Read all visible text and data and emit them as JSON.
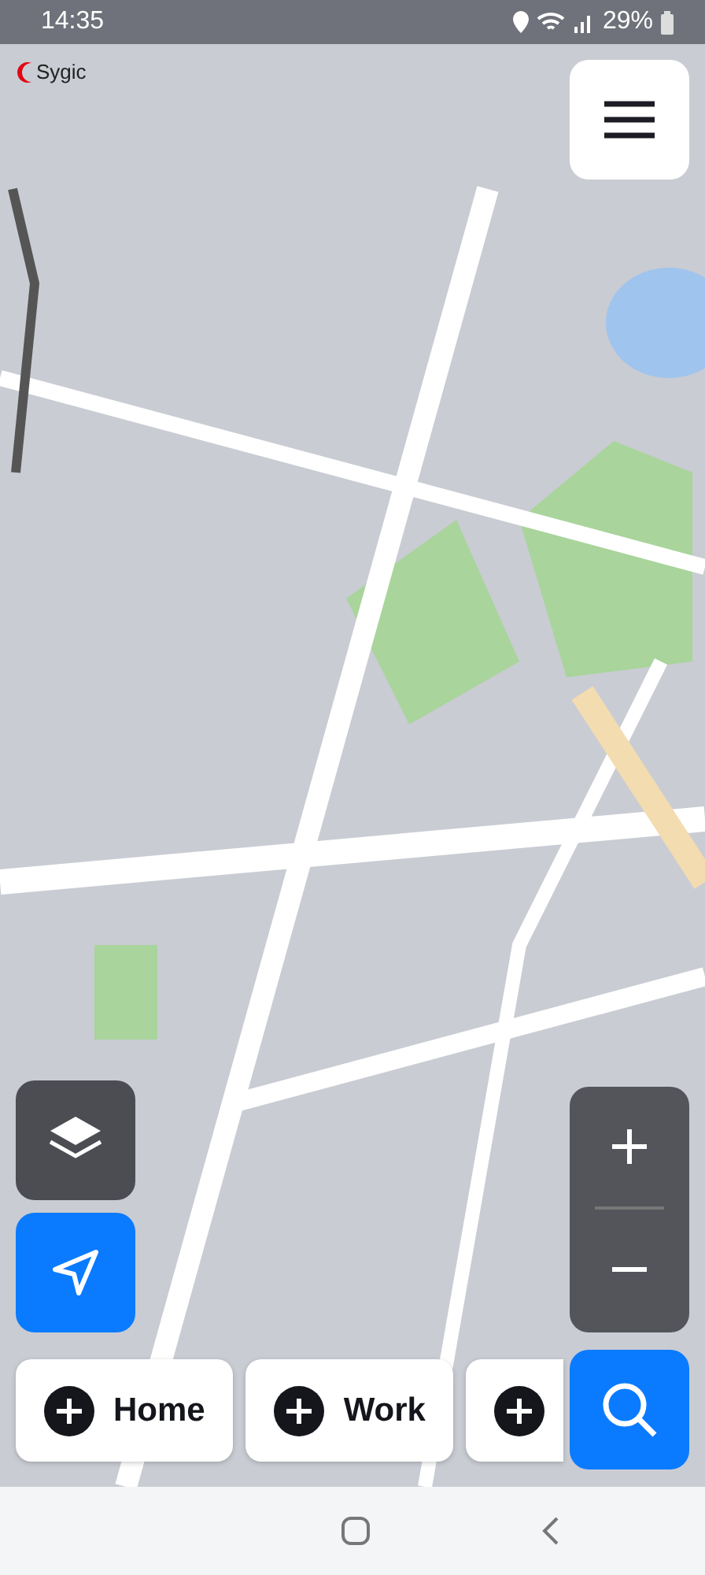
{
  "status_bar": {
    "time": "14:35",
    "battery": "29%"
  },
  "map": {
    "logo": "Sygic"
  },
  "shortcuts": [
    {
      "kind": "labeled",
      "label": "Home"
    },
    {
      "kind": "labeled",
      "label": "Work"
    },
    {
      "kind": "add"
    }
  ]
}
